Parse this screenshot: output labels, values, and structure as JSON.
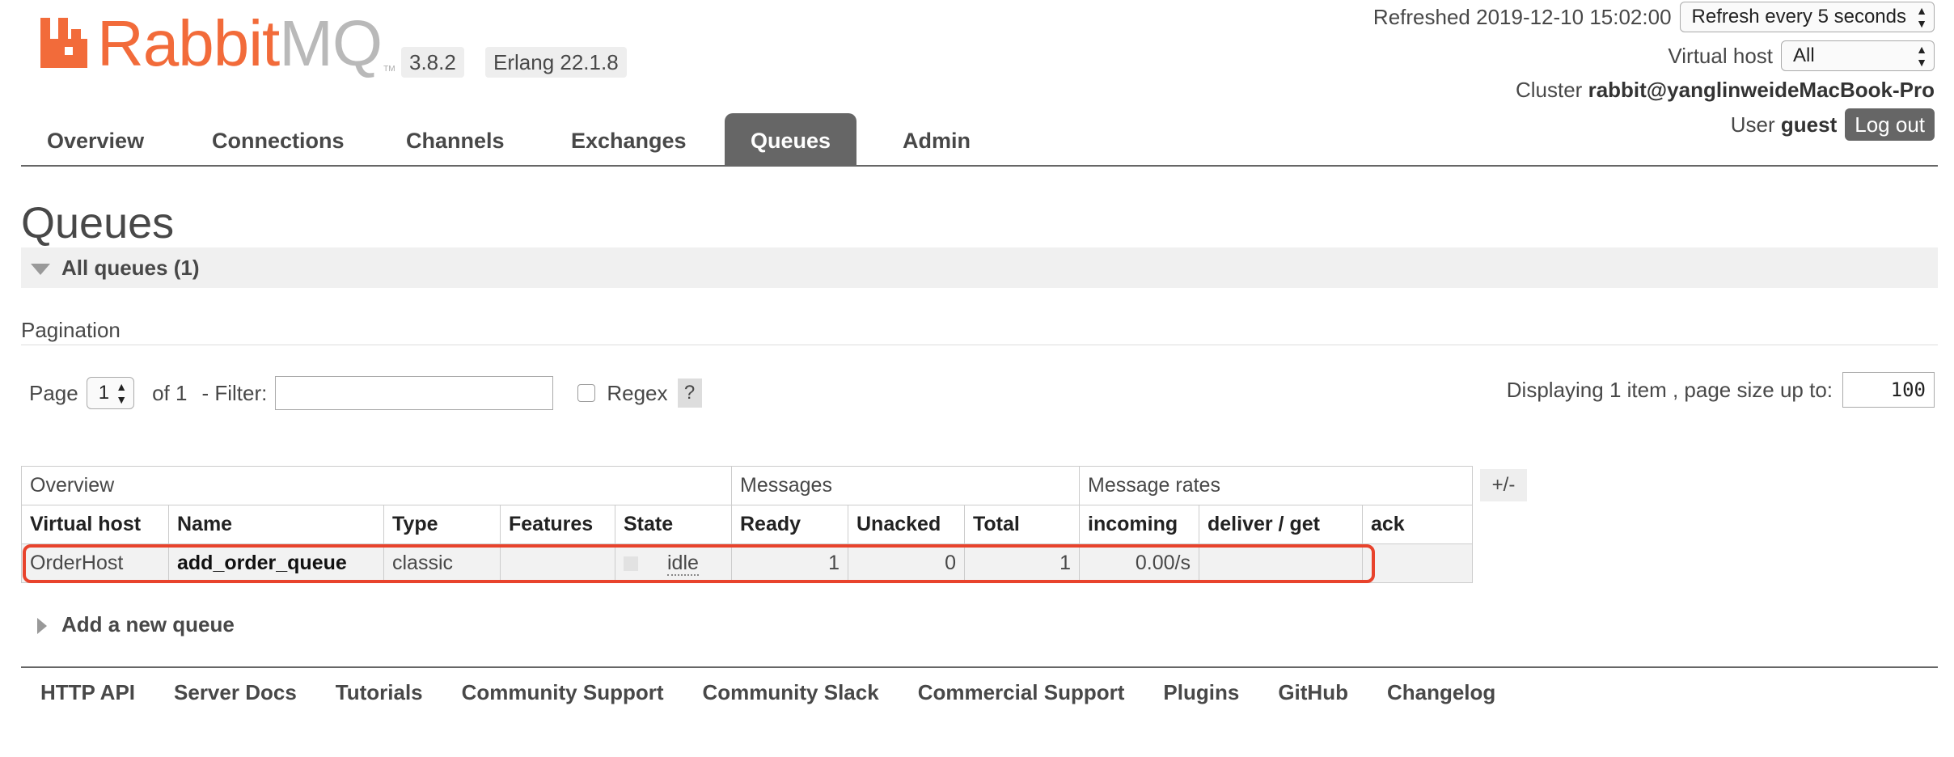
{
  "header": {
    "logo_text": "Rabbit",
    "logo_text_mq": "MQ",
    "logo_tm": "TM",
    "version": "3.8.2",
    "erlang": "Erlang 22.1.8",
    "refreshed_label": "Refreshed 2019-12-10 15:02:00",
    "refresh_select": "Refresh every 5 seconds",
    "virtual_host_label": "Virtual host",
    "virtual_host_select": "All",
    "cluster_label": "Cluster",
    "cluster_value": "rabbit@yanglinweideMacBook-Pro",
    "user_label": "User",
    "user_value": "guest",
    "logout_label": "Log out",
    "brand_color": "#f26b3a"
  },
  "tabs": [
    {
      "label": "Overview",
      "active": false
    },
    {
      "label": "Connections",
      "active": false
    },
    {
      "label": "Channels",
      "active": false
    },
    {
      "label": "Exchanges",
      "active": false
    },
    {
      "label": "Queues",
      "active": true
    },
    {
      "label": "Admin",
      "active": false
    }
  ],
  "page": {
    "title": "Queues",
    "section_title": "All queues (1)",
    "pagination_label": "Pagination",
    "page_label": "Page",
    "page_value": "1",
    "of_label": "of 1",
    "filter_label": "- Filter:",
    "filter_value": "",
    "regex_label": "Regex",
    "help_label": "?",
    "display_label": "Displaying 1 item , page size up to:",
    "page_size": "100"
  },
  "table": {
    "groups": [
      "Overview",
      "Messages",
      "Message rates"
    ],
    "columns": [
      "Virtual host",
      "Name",
      "Type",
      "Features",
      "State",
      "Ready",
      "Unacked",
      "Total",
      "incoming",
      "deliver / get",
      "ack"
    ],
    "rows": [
      {
        "virtual_host": "OrderHost",
        "name": "add_order_queue",
        "type": "classic",
        "features": "",
        "state": "idle",
        "ready": "1",
        "unacked": "0",
        "total": "1",
        "incoming": "0.00/s",
        "deliver_get": "",
        "ack": ""
      }
    ],
    "plus_minus": "+/-"
  },
  "add_queue_label": "Add a new queue",
  "footer": [
    "HTTP API",
    "Server Docs",
    "Tutorials",
    "Community Support",
    "Community Slack",
    "Commercial Support",
    "Plugins",
    "GitHub",
    "Changelog"
  ],
  "highlight_color": "#e8432c"
}
